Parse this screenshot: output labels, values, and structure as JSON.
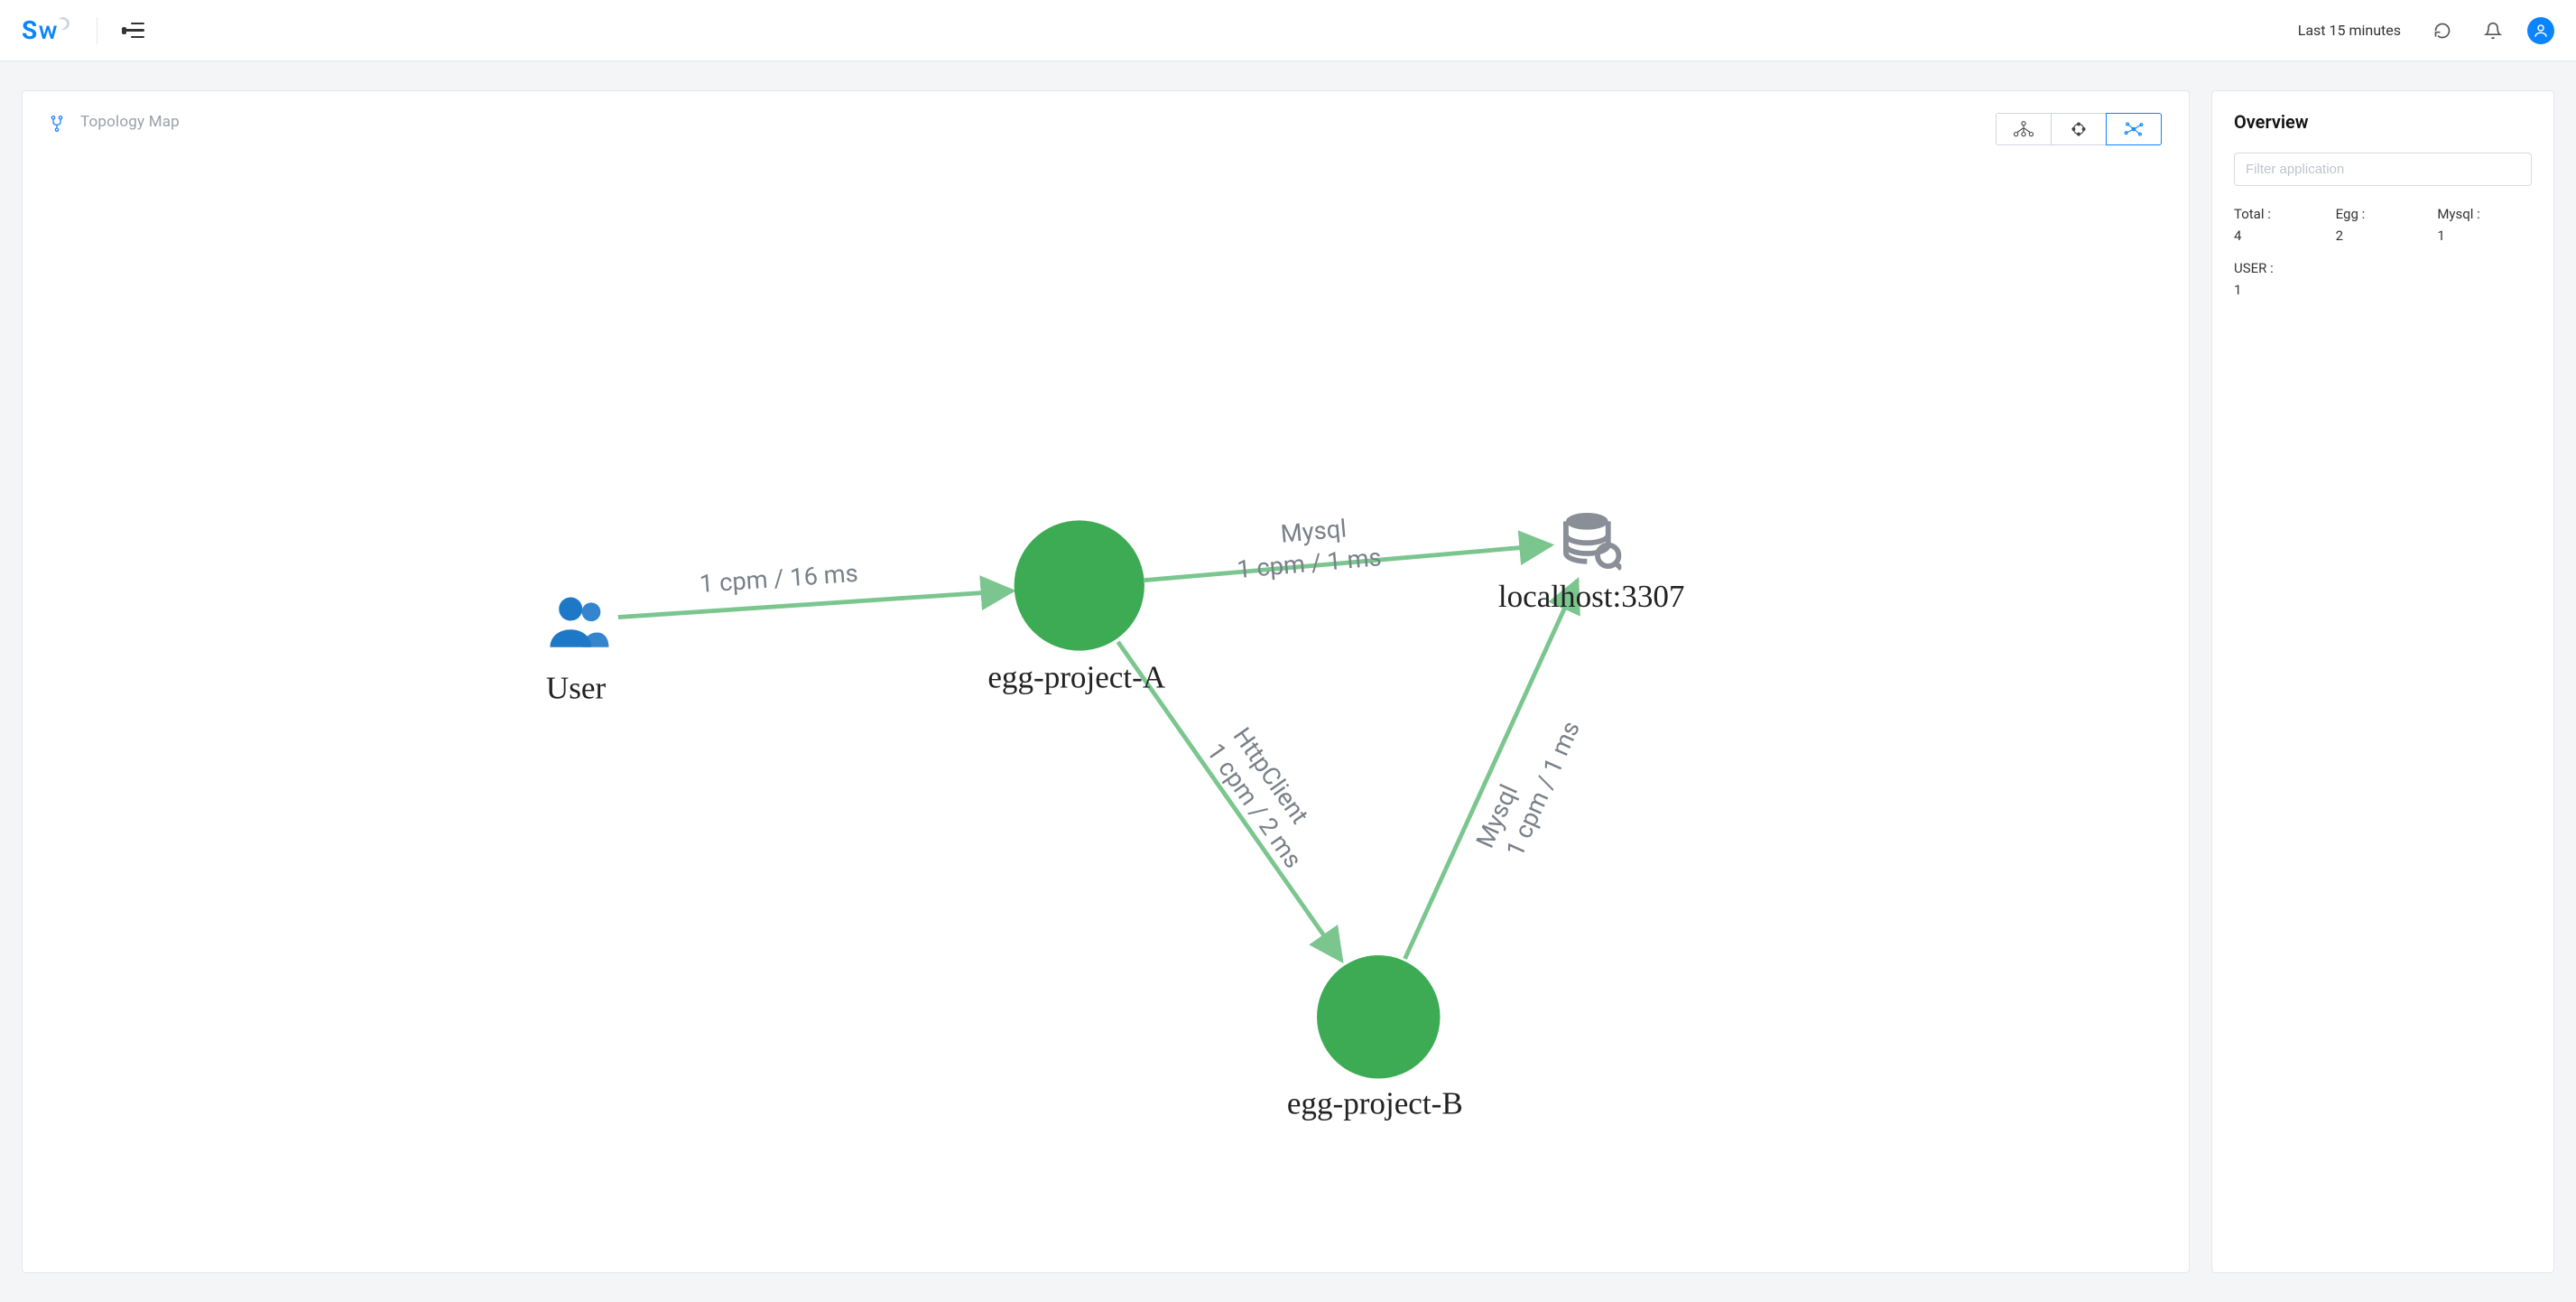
{
  "header": {
    "logo_text_s": "S",
    "logo_text_w": "w",
    "time_range": "Last 15 minutes"
  },
  "topology": {
    "page_title": "Topology Map",
    "nodes": {
      "user": {
        "label": "User",
        "type": "user"
      },
      "eggA": {
        "label": "egg-project-A",
        "type": "service"
      },
      "eggB": {
        "label": "egg-project-B",
        "type": "service"
      },
      "mysql": {
        "label": "localhost:3307",
        "type": "database"
      }
    },
    "edges": {
      "user_to_eggA": {
        "line1": "",
        "line2": "1 cpm / 16 ms"
      },
      "eggA_to_mysql": {
        "line1": "Mysql",
        "line2": "1 cpm / 1 ms"
      },
      "eggA_to_eggB": {
        "line1": "HttpClient",
        "line2": "1 cpm / 2 ms"
      },
      "eggB_to_mysql": {
        "line1": "Mysql",
        "line2": "1 cpm / 1 ms"
      }
    }
  },
  "overview": {
    "title": "Overview",
    "filter_placeholder": "Filter application",
    "stats": {
      "total_label": "Total :",
      "total_value": "4",
      "egg_label": "Egg :",
      "egg_value": "2",
      "mysql_label": "Mysql :",
      "mysql_value": "1",
      "user_label": "USER :",
      "user_value": "1"
    }
  },
  "colors": {
    "accent": "#0a84ff",
    "node_green": "#3cab53",
    "edge_green": "#7bc68f",
    "text_muted": "#9aa0a8"
  }
}
